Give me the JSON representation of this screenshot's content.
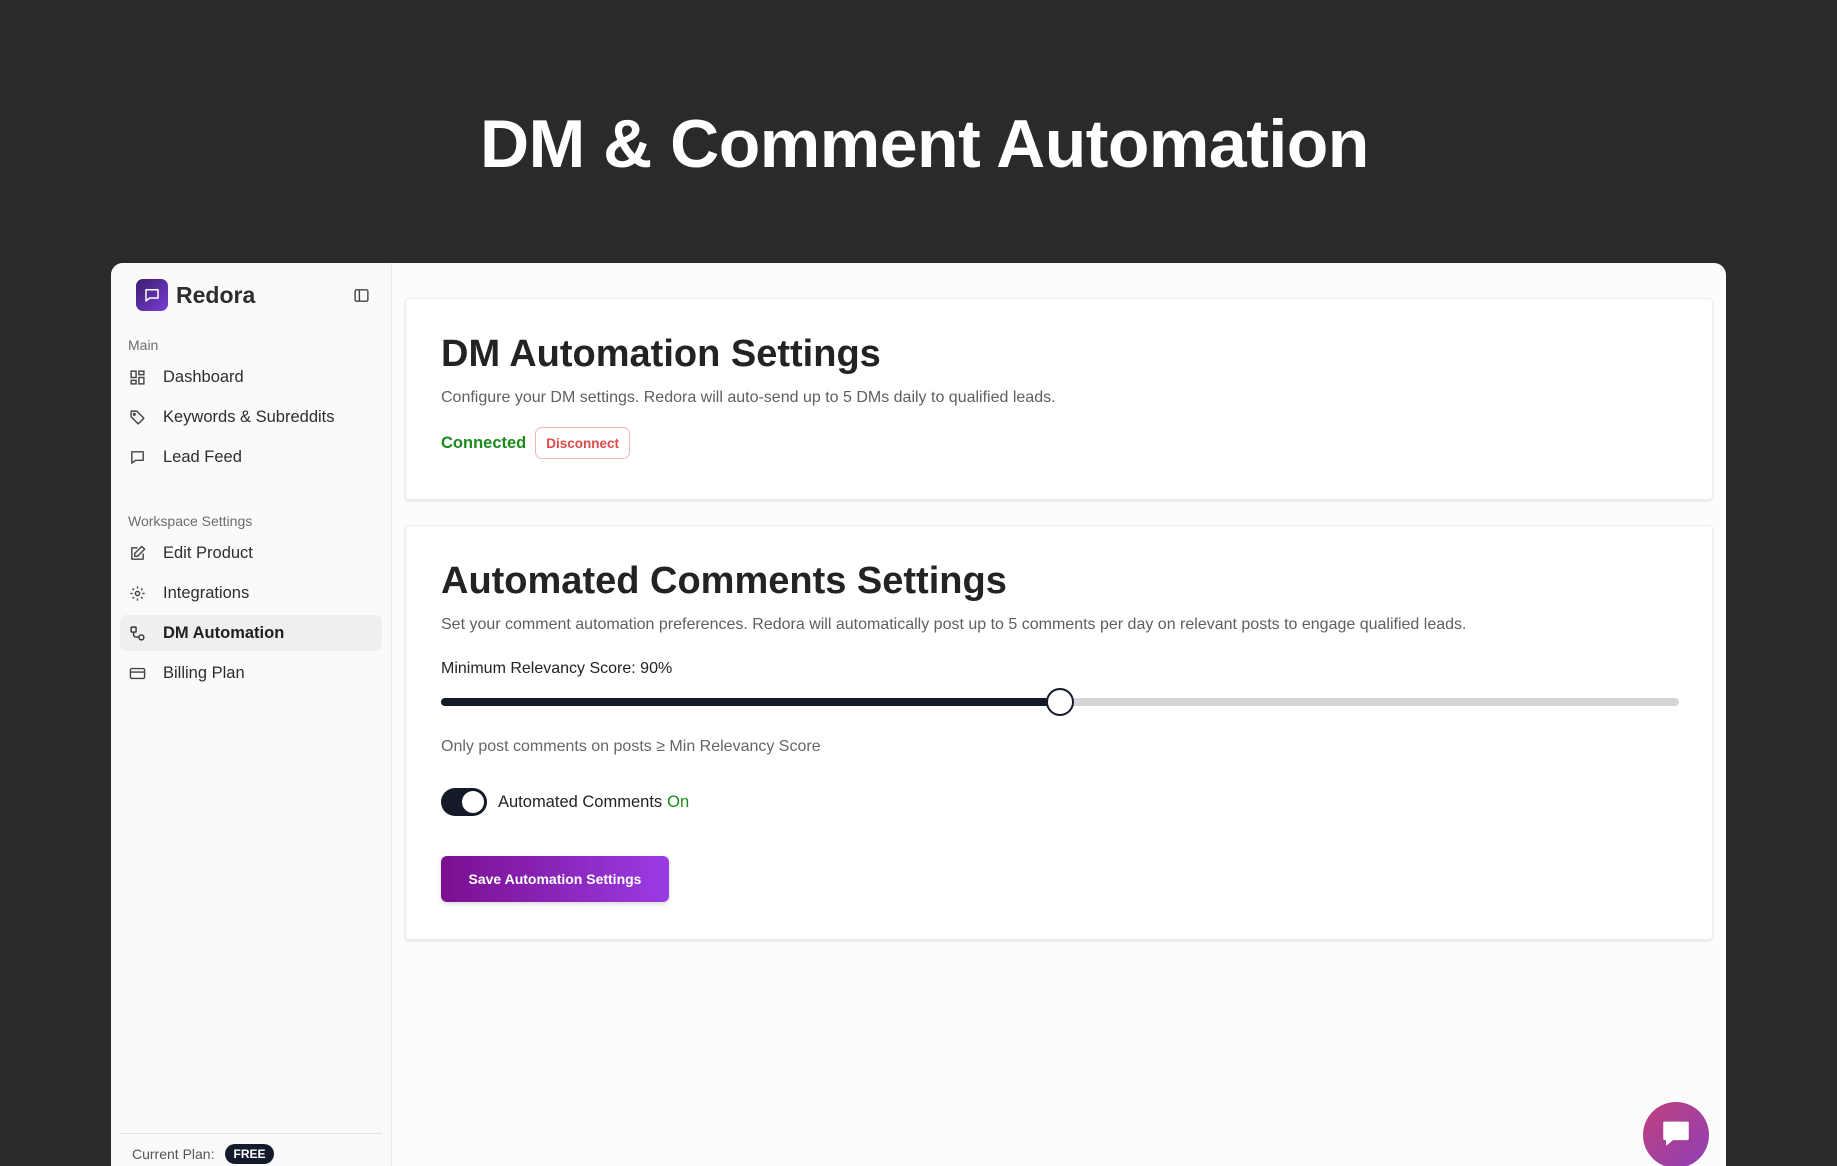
{
  "page": {
    "hero_title": "DM & Comment Automation"
  },
  "brand": {
    "name": "Redora",
    "logo_icon": "chat-bubble-icon",
    "logo_gradient": [
      "#3a1c6e",
      "#7b3fd6"
    ]
  },
  "sidebar": {
    "sections": [
      {
        "label": "Main",
        "items": [
          {
            "label": "Dashboard",
            "icon": "dashboard-icon",
            "active": false
          },
          {
            "label": "Keywords & Subreddits",
            "icon": "tag-icon",
            "active": false
          },
          {
            "label": "Lead Feed",
            "icon": "message-icon",
            "active": false
          }
        ]
      },
      {
        "label": "Workspace Settings",
        "items": [
          {
            "label": "Edit Product",
            "icon": "edit-icon",
            "active": false
          },
          {
            "label": "Integrations",
            "icon": "gear-icon",
            "active": false
          },
          {
            "label": "DM Automation",
            "icon": "workflow-icon",
            "active": true
          },
          {
            "label": "Billing Plan",
            "icon": "credit-card-icon",
            "active": false
          }
        ]
      }
    ],
    "footer": {
      "plan_label": "Current Plan:",
      "plan_value": "FREE"
    }
  },
  "dm_card": {
    "title": "DM Automation Settings",
    "description": "Configure your DM settings. Redora will auto-send up to 5 DMs daily to qualified leads.",
    "status": "Connected",
    "disconnect_label": "Disconnect"
  },
  "comments_card": {
    "title": "Automated Comments Settings",
    "description": "Set your comment automation preferences. Redora will automatically post up to 5 comments per day on relevant posts to engage qualified leads.",
    "slider_label": "Minimum Relevancy Score: 90%",
    "slider_fraction": 0.5,
    "slider_note": "Only post comments on posts ≥ Min Relevancy Score",
    "toggle_label": "Automated Comments",
    "toggle_state": "On",
    "toggle_on": true,
    "save_label": "Save Automation Settings"
  },
  "colors": {
    "accent_green": "#1c8a1c",
    "danger": "#e04a4a",
    "dark": "#141a28",
    "save_gradient": [
      "#7a0f8f",
      "#9b3be4"
    ]
  }
}
